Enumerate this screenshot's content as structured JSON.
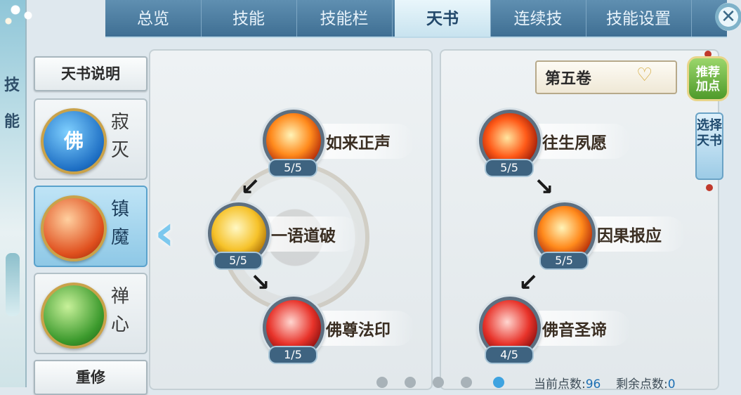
{
  "sidebar_strip": {
    "text_line1": "技",
    "text_line2": "能"
  },
  "tabs": [
    {
      "label": "总览"
    },
    {
      "label": "技能"
    },
    {
      "label": "技能栏"
    },
    {
      "label": "天书",
      "active": true
    },
    {
      "label": "连续技"
    },
    {
      "label": "技能设置"
    }
  ],
  "close_label": "✕",
  "left_panel": {
    "info_button": "天书说明",
    "books": [
      {
        "orb_glyph": "佛",
        "name_line1": "寂",
        "name_line2": "灭",
        "color": "#1e6fc4"
      },
      {
        "orb_glyph": "",
        "name_line1": "镇",
        "name_line2": "魔",
        "color": "#e0501e",
        "selected": true
      },
      {
        "orb_glyph": "",
        "name_line1": "禅",
        "name_line2": "心",
        "color": "#3c9a2d"
      }
    ],
    "reset_button": "重修"
  },
  "nav_arrow": "‹",
  "volume": {
    "selected": "第五卷"
  },
  "recommend_button": {
    "line1": "推荐",
    "line2": "加点"
  },
  "choose_book_button": {
    "line1": "选择",
    "line2": "天书"
  },
  "skills_left": [
    {
      "name": "如来正声",
      "level": "5/5",
      "icon": "fire-palm-icon"
    },
    {
      "name": "一语道破",
      "level": "5/5",
      "icon": "golden-buddha-icon"
    },
    {
      "name": "佛尊法印",
      "level": "1/5",
      "icon": "red-slash-icon"
    }
  ],
  "skills_right": [
    {
      "name": "往生夙愿",
      "level": "5/5",
      "icon": "seated-monk-fire-icon"
    },
    {
      "name": "因果报应",
      "level": "5/5",
      "icon": "flame-orb-icon"
    },
    {
      "name": "佛音圣谛",
      "level": "4/5",
      "icon": "ember-swirl-icon"
    }
  ],
  "points": {
    "current_label": "当前点数:",
    "current_value": "96",
    "remaining_label": "剩余点数:",
    "remaining_value": "0"
  },
  "page_dots": 5,
  "active_page_index": 4
}
